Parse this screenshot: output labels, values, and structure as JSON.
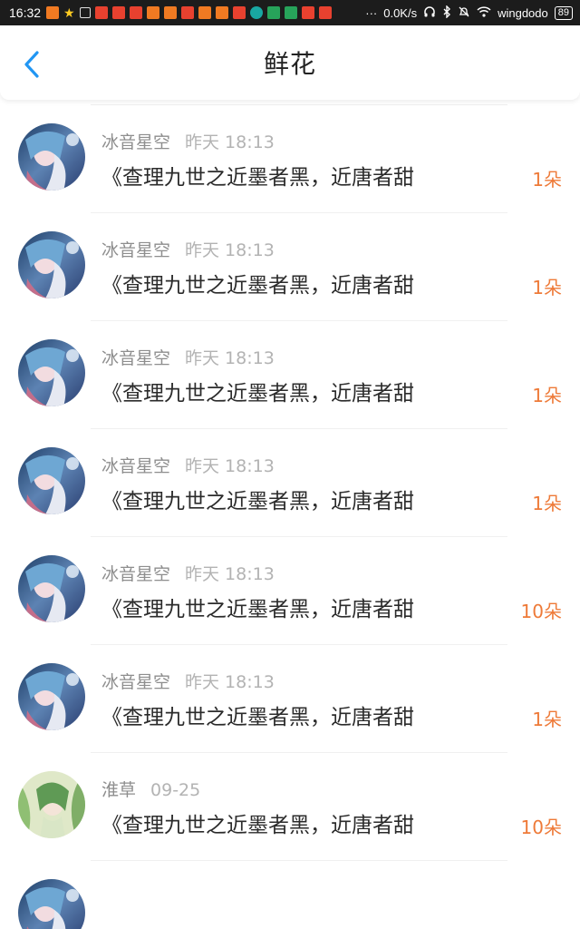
{
  "status_bar": {
    "time": "16:32",
    "net_speed": "0.0K/s",
    "wifi_name": "wingdodo",
    "battery": "89",
    "more": "···"
  },
  "header": {
    "title": "鲜花"
  },
  "items": [
    {
      "name": "",
      "time": "",
      "message": "《查理九世之近墨者黑，近唐者甜",
      "count": "1朵",
      "avatar": "blue"
    },
    {
      "name": "冰音星空",
      "time": "昨天 18:13",
      "message": "《查理九世之近墨者黑，近唐者甜",
      "count": "1朵",
      "avatar": "blue"
    },
    {
      "name": "冰音星空",
      "time": "昨天 18:13",
      "message": "《查理九世之近墨者黑，近唐者甜",
      "count": "1朵",
      "avatar": "blue"
    },
    {
      "name": "冰音星空",
      "time": "昨天 18:13",
      "message": "《查理九世之近墨者黑，近唐者甜",
      "count": "1朵",
      "avatar": "blue"
    },
    {
      "name": "冰音星空",
      "time": "昨天 18:13",
      "message": "《查理九世之近墨者黑，近唐者甜",
      "count": "1朵",
      "avatar": "blue"
    },
    {
      "name": "冰音星空",
      "time": "昨天 18:13",
      "message": "《查理九世之近墨者黑，近唐者甜",
      "count": "10朵",
      "avatar": "blue"
    },
    {
      "name": "冰音星空",
      "time": "昨天 18:13",
      "message": "《查理九世之近墨者黑，近唐者甜",
      "count": "1朵",
      "avatar": "blue"
    },
    {
      "name": "淮草",
      "time": "09-25",
      "message": "《查理九世之近墨者黑，近唐者甜",
      "count": "10朵",
      "avatar": "green"
    },
    {
      "name": "",
      "time": "",
      "message": "",
      "count": "",
      "avatar": "blue"
    }
  ],
  "colors": {
    "accent_blue": "#2196f3",
    "count_orange": "#ee7a38"
  }
}
